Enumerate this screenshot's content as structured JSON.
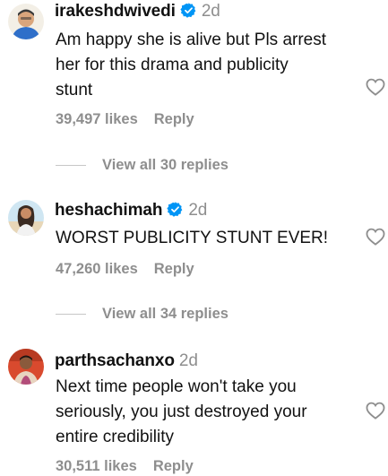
{
  "comments": [
    {
      "username": "irakeshdwivedi",
      "verified": true,
      "time": "2d",
      "lines": [
        "Am happy she is alive but Pls arrest",
        "her for this drama and publicity",
        "stunt"
      ],
      "likes": "39,497 likes",
      "reply_label": "Reply",
      "view_replies": "View all 30 replies"
    },
    {
      "username": "heshachimah",
      "verified": true,
      "time": "2d",
      "lines": [
        "WORST PUBLICITY STUNT EVER!"
      ],
      "likes": "47,260 likes",
      "reply_label": "Reply",
      "view_replies": "View all 34 replies"
    },
    {
      "username": "parthsachanxo",
      "verified": false,
      "time": "2d",
      "lines": [
        "Next time people won't take you",
        "seriously, you just destroyed your",
        "entire credibility"
      ],
      "likes": "30,511 likes",
      "reply_label": "Reply"
    }
  ],
  "icons": {
    "verified": "verified-badge-icon",
    "like": "heart-outline-icon"
  },
  "colors": {
    "verified_blue": "#0095f6",
    "muted_text": "#8e8e8e",
    "primary_text": "#111111"
  }
}
